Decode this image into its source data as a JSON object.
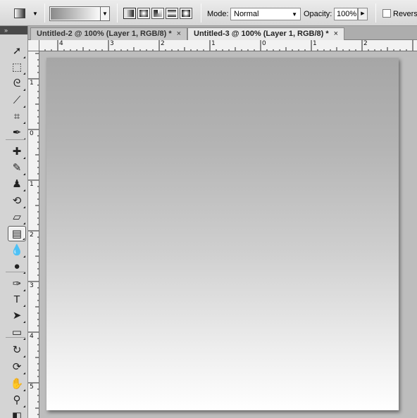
{
  "options_bar": {
    "tool_preset_icon": "gradient-tool-icon",
    "gradient_picker": {
      "from_color": "#8a8a8a",
      "to_color": "#fafafa"
    },
    "gradient_types": [
      "linear",
      "radial",
      "angle",
      "reflected",
      "diamond"
    ],
    "selected_gradient_type": "linear",
    "mode_label": "Mode:",
    "mode_value": "Normal",
    "opacity_label": "Opacity:",
    "opacity_value": "100%",
    "reverse_label": "Reverse"
  },
  "tabs": [
    {
      "label": "Untitled-2 @ 100% (Layer 1, RGB/8) *",
      "close": "×",
      "active": false
    },
    {
      "label": "Untitled-3 @ 100% (Layer 1, RGB/8) *",
      "close": "×",
      "active": true
    }
  ],
  "panel_header": "»",
  "rulers": {
    "horizontal_labels": [
      "4",
      "3",
      "2",
      "1",
      "0",
      "1",
      "2"
    ],
    "vertical_labels": [
      "1",
      "0",
      "1",
      "2",
      "3",
      "4",
      "5"
    ]
  },
  "tools": [
    {
      "name": "move-tool-icon",
      "glyph": "➚"
    },
    {
      "name": "marquee-tool-icon",
      "glyph": "⬚"
    },
    {
      "name": "lasso-tool-icon",
      "glyph": "ᘓ"
    },
    {
      "name": "magic-wand-tool-icon",
      "glyph": "⟋"
    },
    {
      "name": "crop-tool-icon",
      "glyph": "⌗"
    },
    {
      "name": "eyedropper-tool-icon",
      "glyph": "✒"
    },
    {
      "name": "healing-brush-tool-icon",
      "glyph": "✚"
    },
    {
      "name": "brush-tool-icon",
      "glyph": "✎"
    },
    {
      "name": "clone-stamp-tool-icon",
      "glyph": "♟"
    },
    {
      "name": "history-brush-tool-icon",
      "glyph": "⟲"
    },
    {
      "name": "eraser-tool-icon",
      "glyph": "▱"
    },
    {
      "name": "gradient-tool-icon",
      "glyph": "▤",
      "active": true
    },
    {
      "name": "blur-tool-icon",
      "glyph": "💧"
    },
    {
      "name": "dodge-tool-icon",
      "glyph": "●"
    },
    {
      "name": "pen-tool-icon",
      "glyph": "✑"
    },
    {
      "name": "type-tool-icon",
      "glyph": "T"
    },
    {
      "name": "path-selection-tool-icon",
      "glyph": "➤"
    },
    {
      "name": "shape-tool-icon",
      "glyph": "▭"
    },
    {
      "name": "3d-rotate-tool-icon",
      "glyph": "↻"
    },
    {
      "name": "3d-orbit-tool-icon",
      "glyph": "⟳"
    },
    {
      "name": "hand-tool-icon",
      "glyph": "✋"
    },
    {
      "name": "zoom-tool-icon",
      "glyph": "⚲"
    },
    {
      "name": "color-swatches-icon",
      "glyph": "◧"
    }
  ],
  "colors": {
    "canvas_top": "#a6a6a6",
    "canvas_bottom": "#ffffff",
    "workspace": "#bdbdbd"
  }
}
